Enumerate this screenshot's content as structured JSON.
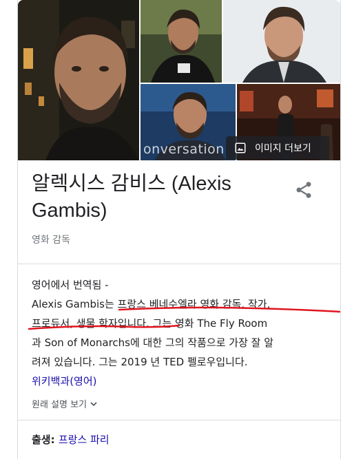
{
  "photos": {
    "overlay_text": "onversation",
    "more_images_label": "이미지 더보기",
    "more_images_icon": "image-icon"
  },
  "entity": {
    "title_line1": "알렉시스 감비스 (Alexis",
    "title_line2": "Gambis)",
    "subtitle": "영화 감독",
    "share_icon": "share-icon"
  },
  "description": {
    "translated_prefix": "영어에서 번역됨 -",
    "line2_a": "Alexis Gambis는 ",
    "line2_b": "프랑스 베네수엘라 영화 감독, 작가,",
    "line3_a": "프로듀서, 생물 학자입니다.",
    "line3_b": " 그는 영화 The Fly Room",
    "line4": "과 Son of Monarchs에 대한 그의 작품으로 가장 잘 알",
    "line5": "려져 있습니다. 그는 2019 년 TED 펠로우입니다.",
    "source_link": "위키백과(영어)",
    "original_toggle": "원래 설명 보기"
  },
  "facts": {
    "born_label": "출생",
    "born_colon": ": ",
    "born_value": "프랑스 파리"
  },
  "colors": {
    "link": "#1a0dab",
    "annotation_red": "#e0141e",
    "subtle_text": "#70757a",
    "divider": "#dadce0"
  }
}
